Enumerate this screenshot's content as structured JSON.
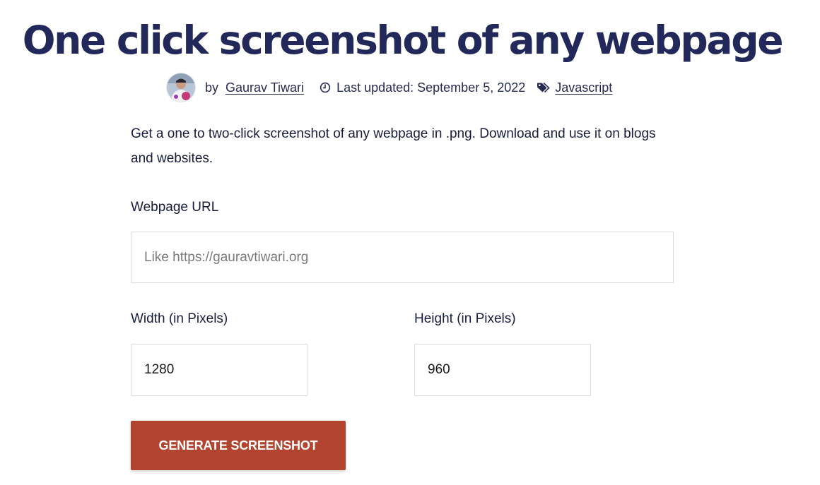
{
  "page": {
    "title": "One click screenshot of any webpage"
  },
  "meta": {
    "avatar_icon": "author-avatar",
    "by_label": "by",
    "author": "Gaurav Tiwari",
    "clock_icon": "clock-icon",
    "last_updated": "Last updated: September 5, 2022",
    "tag_icon": "tags-icon",
    "category": "Javascript"
  },
  "intro": {
    "text": "Get a one to two-click screenshot of any webpage in .png. Download and use it on blogs and websites."
  },
  "form": {
    "url": {
      "label": "Webpage URL",
      "value": "",
      "placeholder": "Like https://gauravtiwari.org"
    },
    "width": {
      "label": "Width (in Pixels)",
      "value": "1280"
    },
    "height": {
      "label": "Height (in Pixels)",
      "value": "960"
    },
    "submit_label": "GENERATE SCREENSHOT"
  },
  "colors": {
    "heading": "#22285a",
    "text": "#171b3c",
    "button": "#b24430",
    "button_text": "#ffffff",
    "border": "#dcdcdc"
  }
}
